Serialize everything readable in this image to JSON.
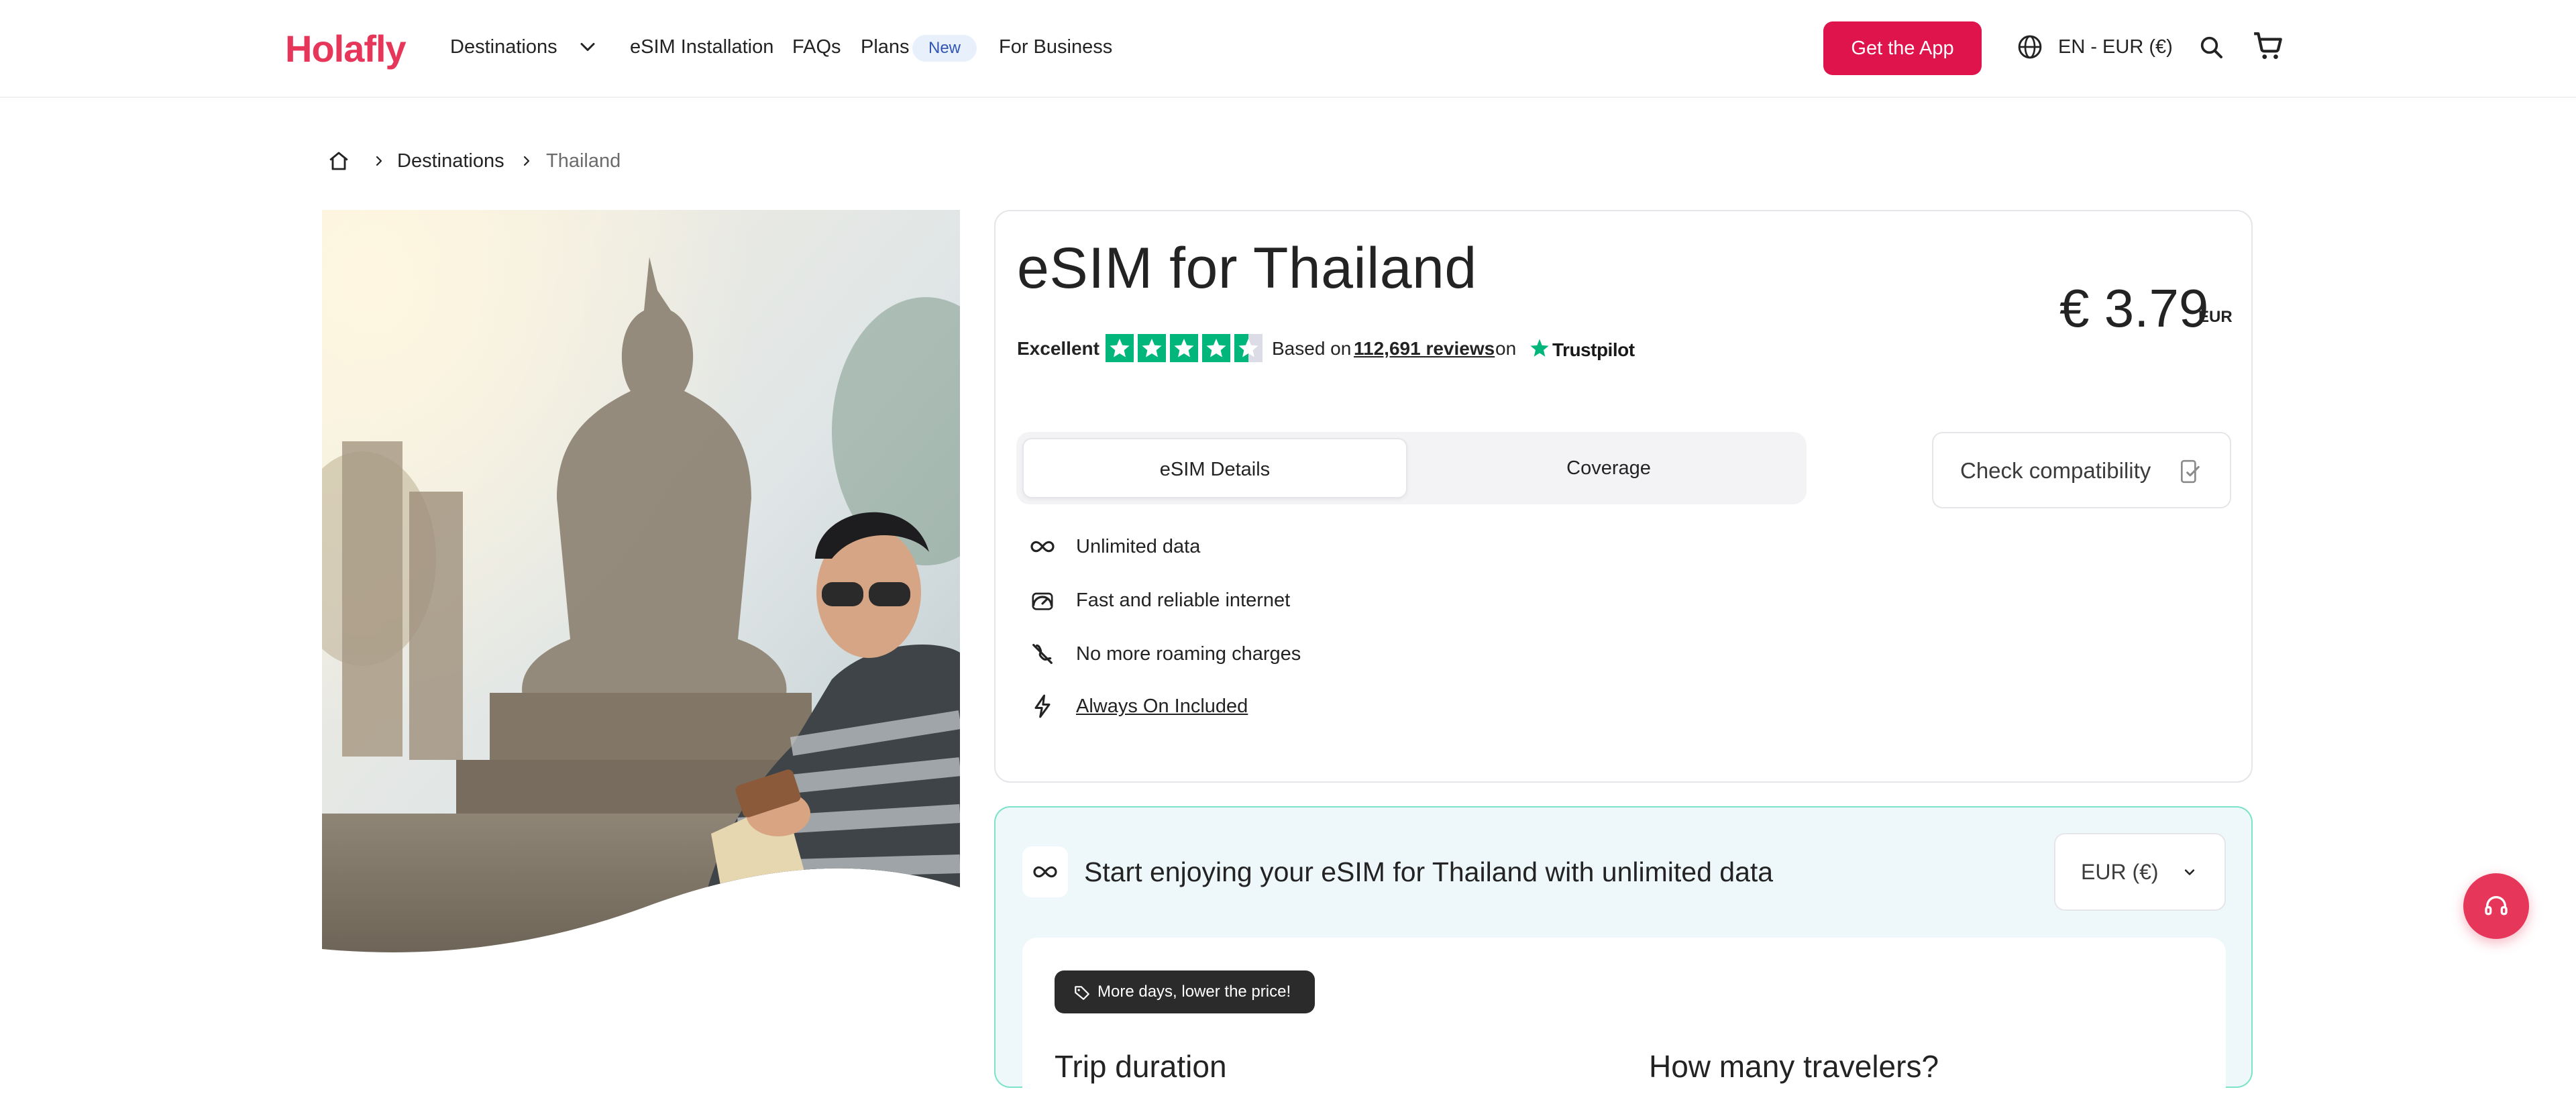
{
  "header": {
    "logo": "Holafly",
    "nav": [
      {
        "label": "Destinations"
      },
      {
        "label": "eSIM Installation"
      },
      {
        "label": "FAQs"
      },
      {
        "label": "Plans"
      },
      {
        "label": "For Business"
      }
    ],
    "plans_badge": "New",
    "get_app": "Get the App",
    "language": "EN - EUR (€)"
  },
  "breadcrumb": {
    "items": [
      "Destinations",
      "Thailand"
    ]
  },
  "product": {
    "title": "eSIM for Thailand",
    "price": "€ 3.79",
    "price_currency": "EUR",
    "rating": {
      "label": "Excellent",
      "stars": 4.5,
      "based_on": "Based on",
      "reviews": "112,691 reviews",
      "on": "on",
      "provider": "Trustpilot"
    },
    "tabs": [
      "eSIM Details",
      "Coverage"
    ],
    "check_compatibility": "Check compatibility",
    "features": [
      {
        "icon": "infinity-icon",
        "label": "Unlimited data"
      },
      {
        "icon": "speedometer-icon",
        "label": "Fast and reliable internet"
      },
      {
        "icon": "no-roaming-icon",
        "label": "No more roaming charges"
      },
      {
        "icon": "bolt-icon",
        "label": "Always On Included"
      }
    ]
  },
  "plan": {
    "title": "Start enjoying your eSIM for Thailand with unlimited data",
    "currency": "EUR (€)",
    "promo": "More days, lower the price!",
    "trip_duration": "Trip duration",
    "travelers": "How many travelers?"
  },
  "colors": {
    "brand": "#e6375a",
    "cta": "#e0144c",
    "trustpilot": "#00b67a",
    "plan_border": "#7de3c8"
  }
}
